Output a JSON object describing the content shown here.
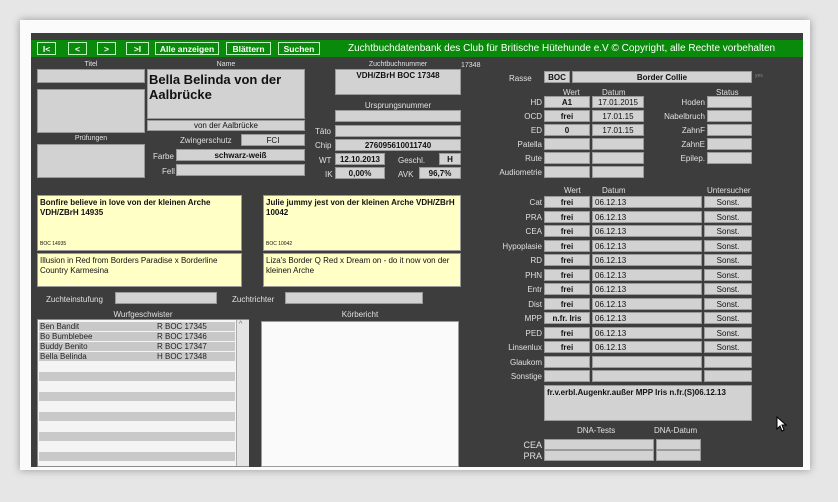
{
  "nav": {
    "first": "I<",
    "prev": "<",
    "next": ">",
    "last": ">I",
    "show_all": "Alle anzeigen",
    "browse": "Blättern",
    "search": "Suchen"
  },
  "window_title": "Zuchtbuchdatenbank des Club für Britische Hütehunde e.V © Copyright, alle Rechte vorbehalten",
  "left": {
    "titel_label": "Titel",
    "name_label": "Name",
    "name": "Bella Belinda von der Aalbrücke",
    "kennel": "von der Aalbrücke",
    "pruefungen_label": "Prüfungen",
    "zwingerschutz_label": "Zwingerschutz",
    "zwingerschutz_value": "FCI",
    "farbe_label": "Farbe",
    "farbe_value": "schwarz-weiß",
    "fell_label": "Fell"
  },
  "mid": {
    "zuchtbuchnummer_label": "Zuchtbuchnummer",
    "zuchtbuchnummer": "VDH/ZBrH BOC 17348",
    "extra_num": "17348",
    "ursprung_label": "Ursprungsnummer",
    "tato_label": "Täto",
    "chip_label": "Chip",
    "chip": "276095610011740",
    "wt_label": "WT",
    "wt": "12.10.2013",
    "geschl_label": "Geschl.",
    "geschl": "H",
    "ik_label": "IK",
    "ik": "0,00%",
    "avk_label": "AVK",
    "avk": "96,7%"
  },
  "parents": {
    "sire": "Bonfire believe in love von der kleinen Arche VDH/ZBrH 14935",
    "sire_code": "BOC 14935",
    "dam": "Julie jummy jest von der kleinen Arche VDH/ZBrH 10042",
    "dam_code": "BOC 10042",
    "sire_parents": "Illusion in Red from Borders Paradise x Borderline Country Karmesina",
    "dam_parents": "Liza's Border Q Red x Dream on - do it now von der kleinen Arche"
  },
  "zuchteinstufung_label": "Zuchteinstufung",
  "zuchtrichter_label": "Zuchtrichter",
  "wurf": {
    "label": "Wurfgeschwister",
    "items": [
      {
        "name": "Ben Bandit",
        "code": "R BOC 17345"
      },
      {
        "name": "Bo Bumblebee",
        "code": "R BOC 17346"
      },
      {
        "name": "Buddy Benito",
        "code": "R BOC 17347"
      },
      {
        "name": "Bella Belinda",
        "code": "H BOC 17348"
      }
    ]
  },
  "koerbericht_label": "Körbericht",
  "rasse": {
    "label": "Rasse",
    "code": "BOC",
    "name": "Border Collie",
    "extra": "yes"
  },
  "hd": {
    "wert_hdr": "Wert",
    "datum_hdr": "Datum",
    "status_hdr": "Status",
    "rows": [
      {
        "label": "HD",
        "wert": "A1",
        "datum": "17.01.2015"
      },
      {
        "label": "OCD",
        "wert": "frei",
        "datum": "17.01.15"
      },
      {
        "label": "ED",
        "wert": "0",
        "datum": "17.01.15"
      },
      {
        "label": "Patella",
        "wert": "",
        "datum": ""
      },
      {
        "label": "Rute",
        "wert": "",
        "datum": ""
      },
      {
        "label": "Audiometrie",
        "wert": "",
        "datum": ""
      }
    ],
    "right_labels": [
      "Hoden",
      "Nabelbruch",
      "ZahnF",
      "ZahnE",
      "Epilep."
    ]
  },
  "eye": {
    "wert_hdr": "Wert",
    "datum_hdr": "Datum",
    "untersucher_hdr": "Untersucher",
    "rows": [
      {
        "label": "Cat",
        "wert": "frei",
        "datum": "06.12.13",
        "u": "Sonst."
      },
      {
        "label": "PRA",
        "wert": "frei",
        "datum": "06.12.13",
        "u": "Sonst."
      },
      {
        "label": "CEA",
        "wert": "frei",
        "datum": "06.12.13",
        "u": "Sonst."
      },
      {
        "label": "Hypoplasie",
        "wert": "frei",
        "datum": "06.12.13",
        "u": "Sonst."
      },
      {
        "label": "RD",
        "wert": "frei",
        "datum": "06.12.13",
        "u": "Sonst."
      },
      {
        "label": "PHN",
        "wert": "frei",
        "datum": "06.12.13",
        "u": "Sonst."
      },
      {
        "label": "Entr",
        "wert": "frei",
        "datum": "06.12.13",
        "u": "Sonst."
      },
      {
        "label": "Dist",
        "wert": "frei",
        "datum": "06.12.13",
        "u": "Sonst."
      },
      {
        "label": "MPP",
        "wert": "n.fr. Iris",
        "datum": "06.12.13",
        "u": "Sonst."
      },
      {
        "label": "PED",
        "wert": "frei",
        "datum": "06.12.13",
        "u": "Sonst."
      },
      {
        "label": "Linsenlux",
        "wert": "frei",
        "datum": "06.12.13",
        "u": "Sonst."
      },
      {
        "label": "Glaukom",
        "wert": "",
        "datum": "",
        "u": ""
      },
      {
        "label": "Sonstige",
        "wert": "",
        "datum": "",
        "u": ""
      }
    ],
    "note": "fr.v.erbl.Augenkr.außer MPP Iris n.fr.(S)06.12.13"
  },
  "dna": {
    "tests_hdr": "DNA-Tests",
    "datum_hdr": "DNA-Datum",
    "rows": [
      "CEA",
      "PRA"
    ]
  }
}
